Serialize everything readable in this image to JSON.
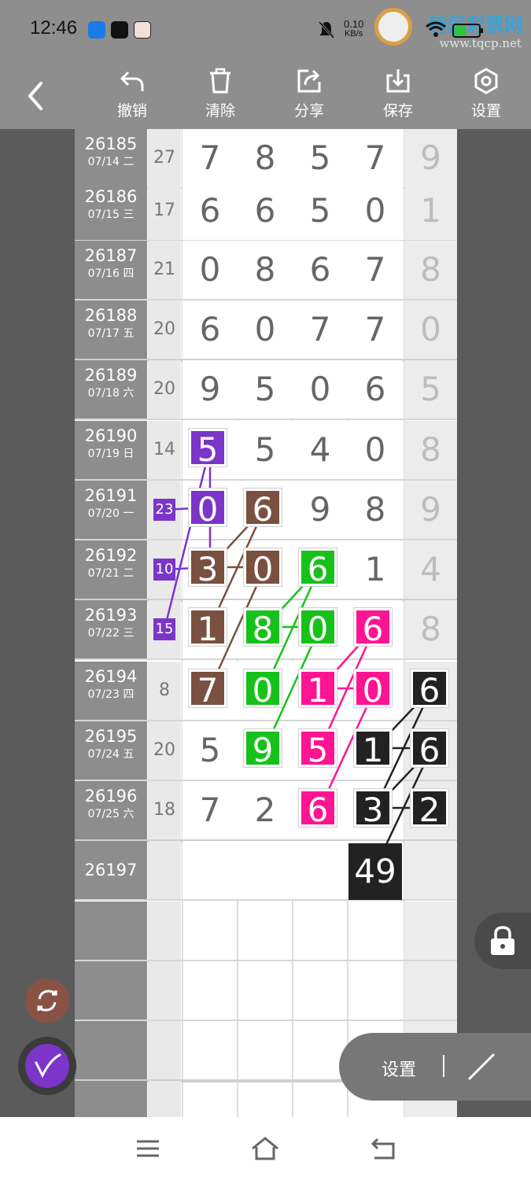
{
  "status_bar": {
    "time": "12:46",
    "net_speed": "0.10",
    "net_unit": "KB/s",
    "watermark_text": "特区彩票网",
    "watermark_url": "www.tqcp.net",
    "icons": [
      "app-blue-icon",
      "tiktok-icon",
      "avatar-icon",
      "mute-icon",
      "signal-icon",
      "wifi-icon",
      "battery-icon"
    ]
  },
  "toolbar": {
    "undo": "撤销",
    "clear": "清除",
    "share": "分享",
    "save": "保存",
    "settings": "设置"
  },
  "rows": [
    {
      "issue": "26185",
      "date": "07/14 二",
      "sum": "27",
      "d": [
        "7",
        "8",
        "5",
        "7",
        "9"
      ]
    },
    {
      "issue": "26186",
      "date": "07/15 三",
      "sum": "17",
      "d": [
        "6",
        "6",
        "5",
        "0",
        "1"
      ]
    },
    {
      "issue": "26187",
      "date": "07/16 四",
      "sum": "21",
      "d": [
        "0",
        "8",
        "6",
        "7",
        "8"
      ]
    },
    {
      "issue": "26188",
      "date": "07/17 五",
      "sum": "20",
      "d": [
        "6",
        "0",
        "7",
        "7",
        "0"
      ]
    },
    {
      "issue": "26189",
      "date": "07/18 六",
      "sum": "20",
      "d": [
        "9",
        "5",
        "0",
        "6",
        "5"
      ]
    },
    {
      "issue": "26190",
      "date": "07/19 日",
      "sum": "14",
      "d": [
        "5",
        "5",
        "4",
        "0",
        "8"
      ]
    },
    {
      "issue": "26191",
      "date": "07/20 一",
      "sum": "23",
      "d": [
        "0",
        "6",
        "9",
        "8",
        "9"
      ]
    },
    {
      "issue": "26192",
      "date": "07/21 二",
      "sum": "10",
      "d": [
        "3",
        "0",
        "6",
        "1",
        "4"
      ]
    },
    {
      "issue": "26193",
      "date": "07/22 三",
      "sum": "15",
      "d": [
        "1",
        "8",
        "0",
        "6",
        "8"
      ]
    },
    {
      "issue": "26194",
      "date": "07/23 四",
      "sum": "8",
      "d": [
        "7",
        "0",
        "1",
        "0",
        "6"
      ]
    },
    {
      "issue": "26195",
      "date": "07/24 五",
      "sum": "20",
      "d": [
        "5",
        "9",
        "5",
        "1",
        "6"
      ]
    },
    {
      "issue": "26196",
      "date": "07/25 六",
      "sum": "18",
      "d": [
        "7",
        "2",
        "6",
        "3",
        "2"
      ]
    },
    {
      "issue": "26197",
      "date": "",
      "sum": "",
      "d": [
        "",
        "",
        "",
        "49",
        ""
      ]
    }
  ],
  "colors": {
    "purple": "#7b35c9",
    "brown": "#7a5040",
    "green": "#16c21a",
    "pink": "#ff1493",
    "black": "#222222"
  },
  "floating": {
    "settings_label": "设置"
  }
}
